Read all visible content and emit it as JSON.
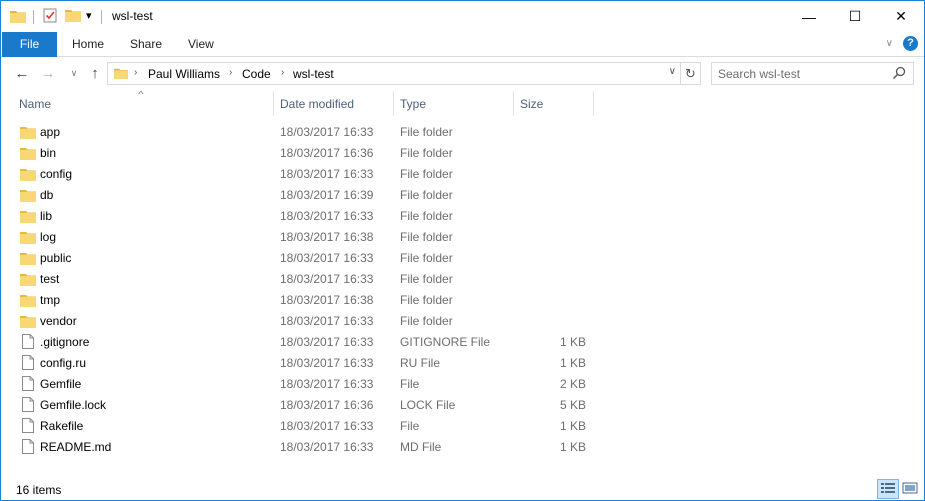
{
  "window": {
    "title": "wsl-test",
    "controls": {
      "minimize": "—",
      "maximize": "☐",
      "close": "✕"
    }
  },
  "quick_access": {
    "dropdown": "▾"
  },
  "ribbon": {
    "tabs": [
      {
        "label": "File"
      },
      {
        "label": "Home"
      },
      {
        "label": "Share"
      },
      {
        "label": "View"
      }
    ],
    "help": "?",
    "expand": "∨"
  },
  "navigation": {
    "back": "←",
    "forward": "→",
    "recent": "∨",
    "up": "↑",
    "breadcrumb": [
      "Paul Williams",
      "Code",
      "wsl-test"
    ],
    "breadcrumb_sep": "›",
    "address_dropdown": "∨",
    "refresh": "↻"
  },
  "search": {
    "placeholder": "Search wsl-test"
  },
  "columns": {
    "name": "Name",
    "date": "Date modified",
    "type": "Type",
    "size": "Size",
    "sort": "^"
  },
  "files": [
    {
      "name": "app",
      "date": "18/03/2017 16:33",
      "type": "File folder",
      "size": "",
      "kind": "folder"
    },
    {
      "name": "bin",
      "date": "18/03/2017 16:36",
      "type": "File folder",
      "size": "",
      "kind": "folder"
    },
    {
      "name": "config",
      "date": "18/03/2017 16:33",
      "type": "File folder",
      "size": "",
      "kind": "folder"
    },
    {
      "name": "db",
      "date": "18/03/2017 16:39",
      "type": "File folder",
      "size": "",
      "kind": "folder"
    },
    {
      "name": "lib",
      "date": "18/03/2017 16:33",
      "type": "File folder",
      "size": "",
      "kind": "folder"
    },
    {
      "name": "log",
      "date": "18/03/2017 16:38",
      "type": "File folder",
      "size": "",
      "kind": "folder"
    },
    {
      "name": "public",
      "date": "18/03/2017 16:33",
      "type": "File folder",
      "size": "",
      "kind": "folder"
    },
    {
      "name": "test",
      "date": "18/03/2017 16:33",
      "type": "File folder",
      "size": "",
      "kind": "folder"
    },
    {
      "name": "tmp",
      "date": "18/03/2017 16:38",
      "type": "File folder",
      "size": "",
      "kind": "folder"
    },
    {
      "name": "vendor",
      "date": "18/03/2017 16:33",
      "type": "File folder",
      "size": "",
      "kind": "folder"
    },
    {
      "name": ".gitignore",
      "date": "18/03/2017 16:33",
      "type": "GITIGNORE File",
      "size": "1 KB",
      "kind": "file"
    },
    {
      "name": "config.ru",
      "date": "18/03/2017 16:33",
      "type": "RU File",
      "size": "1 KB",
      "kind": "file"
    },
    {
      "name": "Gemfile",
      "date": "18/03/2017 16:33",
      "type": "File",
      "size": "2 KB",
      "kind": "file"
    },
    {
      "name": "Gemfile.lock",
      "date": "18/03/2017 16:36",
      "type": "LOCK File",
      "size": "5 KB",
      "kind": "file"
    },
    {
      "name": "Rakefile",
      "date": "18/03/2017 16:33",
      "type": "File",
      "size": "1 KB",
      "kind": "file"
    },
    {
      "name": "README.md",
      "date": "18/03/2017 16:33",
      "type": "MD File",
      "size": "1 KB",
      "kind": "file"
    }
  ],
  "status": {
    "item_count": "16 items"
  },
  "colors": {
    "accent": "#1979ca",
    "folder": "#f8d775",
    "folder_dark": "#e5b83f",
    "column_header": "#4c607a",
    "secondary_text": "#6d6d6d"
  }
}
